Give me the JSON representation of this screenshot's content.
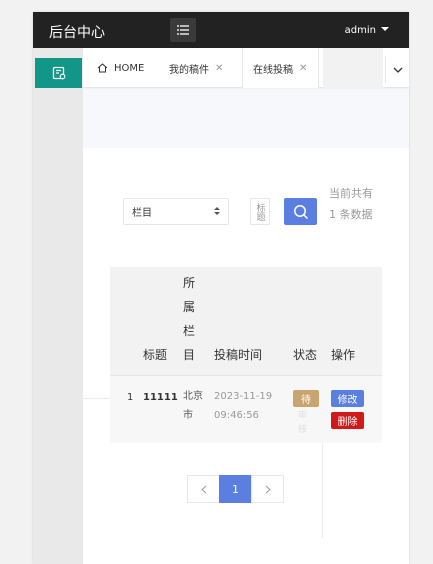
{
  "header": {
    "title": "后台中心",
    "user": "admin"
  },
  "tabs": [
    {
      "label": "HOME",
      "closable": false
    },
    {
      "label": "我的稿件",
      "closable": true
    },
    {
      "label": "在线投稿",
      "closable": true,
      "active": true
    }
  ],
  "tab_close_glyph": "✕",
  "filter": {
    "category_value": "栏目",
    "keyword_placeholder": "标题",
    "count_text": "当前共有 1 条数据"
  },
  "table": {
    "columns": [
      "",
      "标题",
      "所属栏目",
      "投稿时间",
      "状态",
      "操作"
    ],
    "rows": [
      {
        "index": "1",
        "title": "11111",
        "category": "北京市",
        "time": "2023-11-19 09:46:56",
        "status": "待",
        "status_faded": "审核",
        "edit_label": "修改",
        "delete_label": "删除"
      }
    ]
  },
  "pagination": {
    "current": "1"
  },
  "colors": {
    "topbar": "#222222",
    "sidebar_active": "#119688",
    "primary": "#5a7fe0",
    "danger": "#d01a1a",
    "pending": "#c8a470"
  },
  "icons": {
    "menu": "list-icon",
    "sidebar": "document-icon",
    "home": "home-icon",
    "search": "search-icon",
    "more": "chevron-down-icon",
    "prev": "chevron-left-icon",
    "next": "chevron-right-icon"
  }
}
